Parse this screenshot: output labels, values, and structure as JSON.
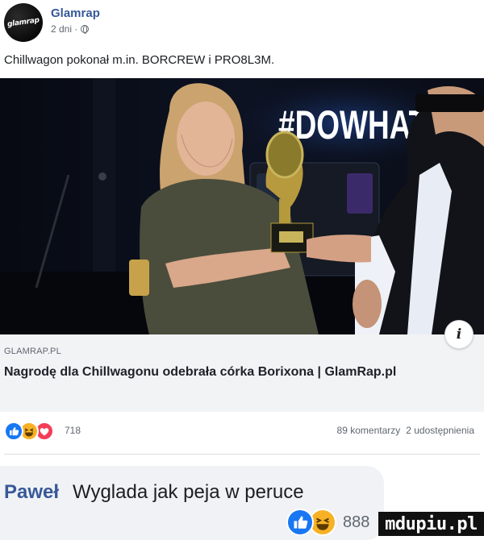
{
  "post": {
    "page_name": "Glamrap",
    "avatar_text": "glamrap",
    "time": "2 dni ·",
    "text": "Chillwagon pokonał m.in. BORCREW i PRO8L3M."
  },
  "photo": {
    "hashtag": "#DOWHATM"
  },
  "link": {
    "domain": "GLAMRAP.PL",
    "headline": "Nagrodę dla Chillwagonu odebrała córka Borixona | GlamRap.pl",
    "info_label": "i"
  },
  "reactions": {
    "count": "718",
    "comments": "89 komentarzy",
    "shares": "2 udostępnienia",
    "icons": [
      "like-icon",
      "haha-icon",
      "love-icon"
    ]
  },
  "comment": {
    "author": "Paweł",
    "text": "Wyglada jak peja w peruce",
    "reaction_count": "888",
    "icons": [
      "like-icon",
      "haha-icon"
    ]
  },
  "watermark": "mdupiu.pl",
  "colors": {
    "link_blue": "#365899",
    "like_blue": "#1877f2",
    "haha_yellow": "#f7b125",
    "love_red": "#f33e58"
  }
}
